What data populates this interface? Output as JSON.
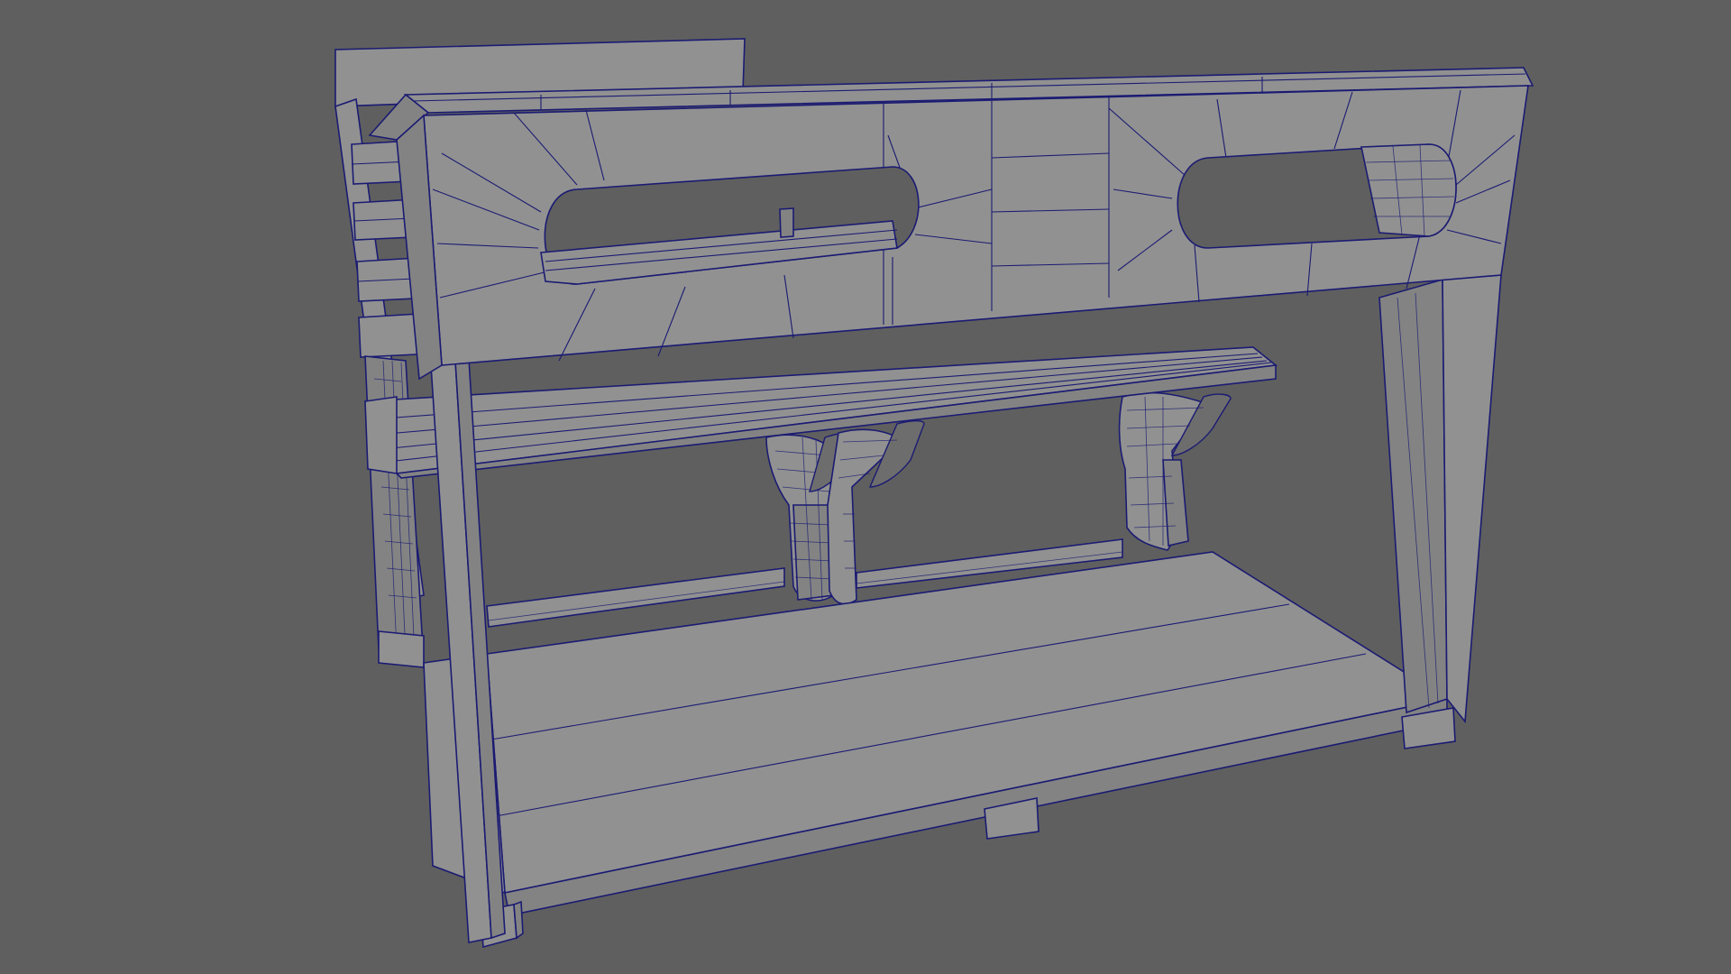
{
  "viewport": {
    "background_color": "#5f5f5f",
    "mesh_face_color": "#919191",
    "mesh_face_dark_color": "#838383",
    "mesh_shadow_color": "#6d6d6d",
    "wireframe_color": "#1b1b73"
  },
  "scene": {
    "object": "polygon-mesh-bench-model",
    "parts": [
      "back-rest",
      "top-beam",
      "window-panel",
      "seat-slats",
      "seat-brackets",
      "side-frame",
      "floor-platform",
      "support-feet"
    ]
  }
}
